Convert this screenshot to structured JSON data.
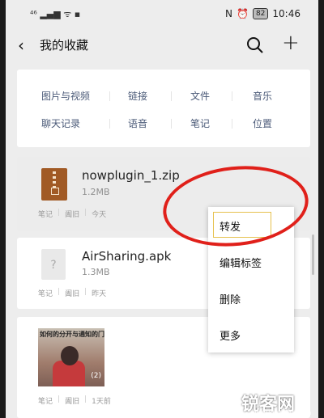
{
  "status_bar": {
    "signal": "⁴⁶",
    "battery": "82",
    "time": "10:46"
  },
  "header": {
    "title": "我的收藏"
  },
  "categories": [
    "图片与视频",
    "链接",
    "文件",
    "音乐",
    "聊天记录",
    "语音",
    "笔记",
    "位置"
  ],
  "items": [
    {
      "name": "nowplugin_1.zip",
      "size": "1.2MB",
      "tag1": "笔记",
      "tag2": "阖旧",
      "time": "今天"
    },
    {
      "name": "AirSharing.apk",
      "size": "1.3MB",
      "tag1": "笔记",
      "tag2": "阖旧",
      "time": "昨天"
    },
    {
      "caption": "如何的分开与通知的门",
      "count": "(2)",
      "tag1": "笔记",
      "tag2": "阖旧",
      "time": "1天前"
    }
  ],
  "context_menu": [
    "转发",
    "编辑标签",
    "删除",
    "更多"
  ],
  "watermark": "锐客网",
  "watermark_url": "www.xiazaiba.com"
}
